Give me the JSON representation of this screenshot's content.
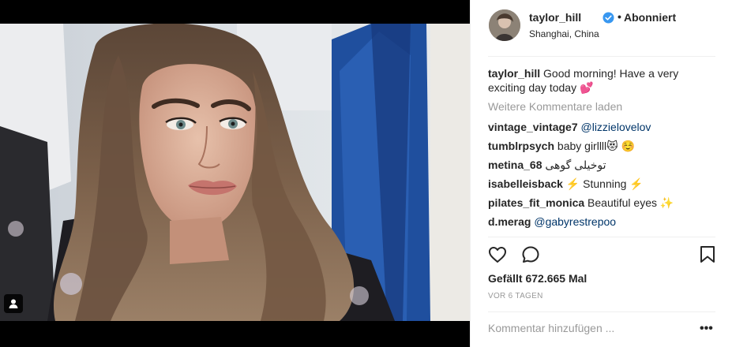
{
  "header": {
    "username": "taylor_hill",
    "separator": "•",
    "follow_label": "Abonniert",
    "location": "Shanghai, China"
  },
  "caption": {
    "username": "taylor_hill",
    "text": "Good morning! Have a very exciting day today 💕"
  },
  "load_more_label": "Weitere Kommentare laden",
  "comments": [
    {
      "username": "vintage_vintage7",
      "text": "@lizzielovelov",
      "is_mention": true
    },
    {
      "username": "tumblrpsych",
      "text": "baby girllll😻 ☺️",
      "is_mention": false
    },
    {
      "username": "metina_68",
      "text": "توخیلی گوهی",
      "is_mention": false
    },
    {
      "username": "isabelleisback",
      "text": "⚡️ Stunning ⚡️",
      "is_mention": false
    },
    {
      "username": "pilates_fit_monica",
      "text": "Beautiful eyes ✨",
      "is_mention": false
    },
    {
      "username": "d.merag",
      "text": "@gabyrestrepoo",
      "is_mention": true
    }
  ],
  "likes": "Gefällt 672.665 Mal",
  "timestamp": "VOR 6 TAGEN",
  "comment_input": {
    "placeholder": "Kommentar hinzufügen ...",
    "value": ""
  },
  "more_options": "•••",
  "icons": {
    "like": "heart-icon",
    "comment": "comment-icon",
    "save": "bookmark-icon",
    "tagged": "user-tag-icon",
    "verified": "verified-badge-icon"
  },
  "colors": {
    "verified": "#3897f0",
    "mention": "#003569",
    "muted": "#999999",
    "text": "#262626"
  }
}
